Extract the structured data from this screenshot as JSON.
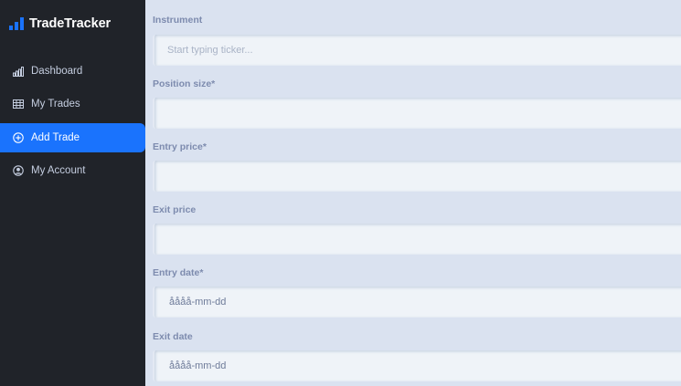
{
  "brand": {
    "name": "TradeTracker"
  },
  "sidebar": {
    "items": [
      {
        "label": "Dashboard",
        "icon": "bar-chart-icon",
        "active": false
      },
      {
        "label": "My Trades",
        "icon": "table-icon",
        "active": false
      },
      {
        "label": "Add Trade",
        "icon": "plus-circle-icon",
        "active": true
      },
      {
        "label": "My Account",
        "icon": "user-circle-icon",
        "active": false
      }
    ]
  },
  "form": {
    "instrument": {
      "label": "Instrument",
      "placeholder": "Start typing ticker..."
    },
    "position_size": {
      "label": "Position size*",
      "value": ""
    },
    "entry_price": {
      "label": "Entry price*",
      "value": ""
    },
    "exit_price": {
      "label": "Exit price",
      "value": ""
    },
    "entry_date": {
      "label": "Entry date*",
      "value": "åååå-mm-dd"
    },
    "exit_date": {
      "label": "Exit date",
      "value": "åååå-mm-dd"
    }
  },
  "colors": {
    "sidebar_bg": "#202329",
    "accent": "#1a73fd",
    "content_bg": "#dae2f0",
    "input_bg": "#eff3f8",
    "label": "#7d8bae"
  }
}
